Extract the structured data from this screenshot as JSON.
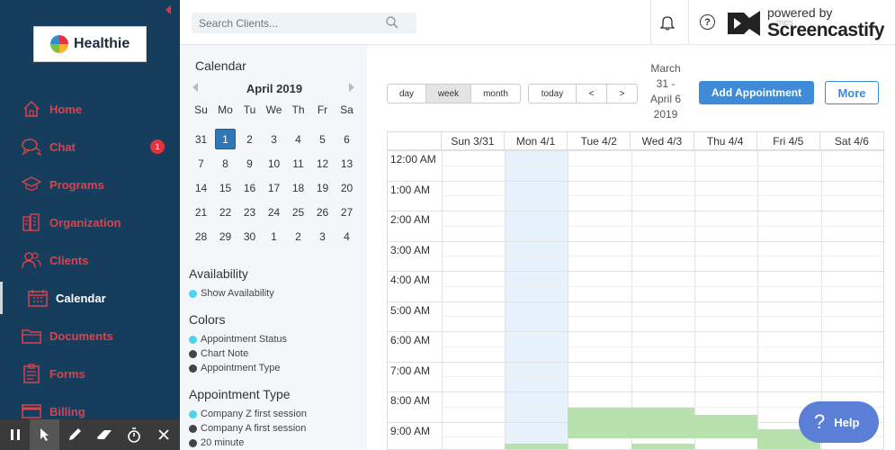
{
  "brand": {
    "name": "Healthie"
  },
  "nav": [
    {
      "label": "Home",
      "icon": "home-icon"
    },
    {
      "label": "Chat",
      "icon": "chat-icon",
      "badge": "1"
    },
    {
      "label": "Programs",
      "icon": "graduation-cap-icon"
    },
    {
      "label": "Organization",
      "icon": "building-icon"
    },
    {
      "label": "Clients",
      "icon": "users-icon"
    },
    {
      "label": "Calendar",
      "icon": "calendar-icon",
      "active": true
    },
    {
      "label": "Documents",
      "icon": "folder-icon"
    },
    {
      "label": "Forms",
      "icon": "clipboard-icon"
    },
    {
      "label": "Billing",
      "icon": "credit-card-icon"
    }
  ],
  "search": {
    "placeholder": "Search Clients..."
  },
  "watermark": {
    "small": "powered by",
    "big": "Screencastify",
    "ghost": "mes"
  },
  "mini_calendar": {
    "title": "Calendar",
    "month": "April 2019",
    "weekdays": [
      "Su",
      "Mo",
      "Tu",
      "We",
      "Th",
      "Fr",
      "Sa"
    ],
    "days": [
      "31",
      "1",
      "2",
      "3",
      "4",
      "5",
      "6",
      "7",
      "8",
      "9",
      "10",
      "11",
      "12",
      "13",
      "14",
      "15",
      "16",
      "17",
      "18",
      "19",
      "20",
      "21",
      "22",
      "23",
      "24",
      "25",
      "26",
      "27",
      "28",
      "29",
      "30",
      "1",
      "2",
      "3",
      "4"
    ],
    "selected_index": 1
  },
  "availability": {
    "title": "Availability",
    "items": [
      {
        "label": "Show Availability",
        "color": "#4fd3e8"
      }
    ]
  },
  "colors": {
    "title": "Colors",
    "items": [
      {
        "label": "Appointment Status",
        "color": "#4fd3e8"
      },
      {
        "label": "Chart Note",
        "color": "#444444"
      },
      {
        "label": "Appointment Type",
        "color": "#444444"
      }
    ]
  },
  "appointment_type": {
    "title": "Appointment Type",
    "items": [
      {
        "label": "Company Z first session",
        "color": "#4fd3e8"
      },
      {
        "label": "Company A first session",
        "color": "#444444"
      },
      {
        "label": "20 minute",
        "color": "#444444"
      }
    ]
  },
  "view_buttons": {
    "day": "day",
    "week": "week",
    "month": "month",
    "active": "week"
  },
  "nav_buttons": {
    "today": "today",
    "prev": "<",
    "next": ">"
  },
  "date_range": [
    "March",
    "31 -",
    "April 6",
    "2019"
  ],
  "actions": {
    "add": "Add Appointment",
    "more": "More"
  },
  "week_columns": [
    "Sun 3/31",
    "Mon 4/1",
    "Tue 4/2",
    "Wed 4/3",
    "Thu 4/4",
    "Fri 4/5",
    "Sat 4/6"
  ],
  "time_labels": [
    "12:00 AM",
    "1:00 AM",
    "2:00 AM",
    "3:00 AM",
    "4:00 AM",
    "5:00 AM",
    "6:00 AM",
    "7:00 AM",
    "8:00 AM",
    "9:00 AM"
  ],
  "help": {
    "label": "Help",
    "glyph": "?"
  },
  "toolbar": [
    "pause-icon",
    "pointer-icon",
    "pen-icon",
    "eraser-icon",
    "timer-icon",
    "close-icon"
  ]
}
